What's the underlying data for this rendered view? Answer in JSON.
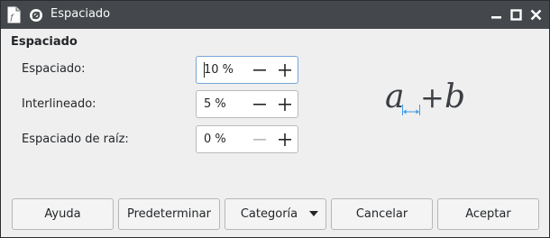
{
  "window": {
    "title": "Espaciado",
    "icons": [
      "app-icon",
      "pin-icon",
      "minimize-icon",
      "maximize-icon",
      "close-icon"
    ]
  },
  "section": {
    "title": "Espaciado"
  },
  "fields": [
    {
      "label": "Espaciado:",
      "value": "10 %",
      "minus_enabled": true
    },
    {
      "label": "Interlineado:",
      "value": "5 %",
      "minus_enabled": true
    },
    {
      "label": "Espaciado de raíz:",
      "value": "0 %",
      "minus_enabled": false
    }
  ],
  "preview": {
    "left": "a",
    "operator": "+",
    "right": "b",
    "indicator_color": "#3d9ae8"
  },
  "buttons": {
    "help": "Ayuda",
    "default": "Predeterminar",
    "category": "Categoría",
    "cancel": "Cancelar",
    "ok": "Aceptar"
  },
  "colors": {
    "titlebar": "#44474b",
    "focus": "#76a7d9",
    "window_bg": "#efefef"
  }
}
